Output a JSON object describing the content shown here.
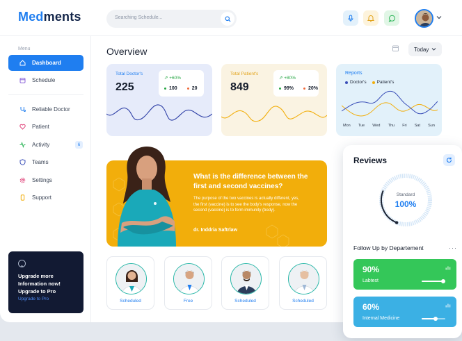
{
  "brand": {
    "part1": "Med",
    "part2": "ments"
  },
  "search": {
    "placeholder": "Searching Schedule..."
  },
  "sidebar": {
    "menu_label": "Menu",
    "items": [
      {
        "label": "Dashboard",
        "icon": "home-icon",
        "active": true
      },
      {
        "label": "Schedule",
        "icon": "calendar-icon"
      },
      {
        "label": "Reliable Doctor",
        "icon": "stethoscope-icon"
      },
      {
        "label": "Patient",
        "icon": "heart-icon"
      },
      {
        "label": "Activity",
        "icon": "activity-icon",
        "badge": "6"
      },
      {
        "label": "Teams",
        "icon": "shield-icon"
      },
      {
        "label": "Settings",
        "icon": "gear-icon"
      },
      {
        "label": "Support",
        "icon": "support-icon"
      }
    ],
    "upgrade": {
      "text": "Upgrade more Information now! Upgrade to Pro",
      "link": "Upgrade to Pro"
    }
  },
  "overview": {
    "title": "Overview",
    "range": "Today"
  },
  "cards": [
    {
      "label": "Total Doctor's",
      "value": "225",
      "change": "+60%",
      "stat1": "100",
      "stat2": "20",
      "bg": "#e6ebfa",
      "label_color": "#1f7ef0"
    },
    {
      "label": "Total Patient's",
      "value": "849",
      "change": "+80%",
      "stat1": "99%",
      "stat2": "20%",
      "bg": "#faf3e2",
      "label_color": "#e2a31a"
    }
  ],
  "reports": {
    "title": "Reports",
    "legend": [
      {
        "name": "Doctor's",
        "color": "#3a4fb8"
      },
      {
        "name": "Patient's",
        "color": "#f2ae0b"
      }
    ],
    "days": [
      "Mon",
      "Tue",
      "Wed",
      "Thu",
      "Fri",
      "Sat",
      "Sun"
    ]
  },
  "banner": {
    "heading": "What is the difference between the first and second vaccines?",
    "body": "The purpose of the two vaccines is actually different, yes, the first (vaccine) is to see the body's response, now the second (vaccine) is to form immunity (body).",
    "author": "dr. Inddria Saftrlaw"
  },
  "doctors": [
    {
      "status": "Scheduled"
    },
    {
      "status": "Free"
    },
    {
      "status": "Scheduled"
    },
    {
      "status": "Scheduled"
    }
  ],
  "reviews": {
    "title": "Reviews",
    "gauge_label": "Standard",
    "gauge_value": "100%",
    "gauge_fraction": 1.0,
    "followup_title": "Follow Up by Departement",
    "departments": [
      {
        "percent": "90%",
        "name": "Labtest",
        "level": 0.9,
        "color": "#34c759"
      },
      {
        "percent": "60%",
        "name": "Internal Medicine",
        "level": 0.6,
        "color": "#3bb0e4"
      }
    ]
  }
}
